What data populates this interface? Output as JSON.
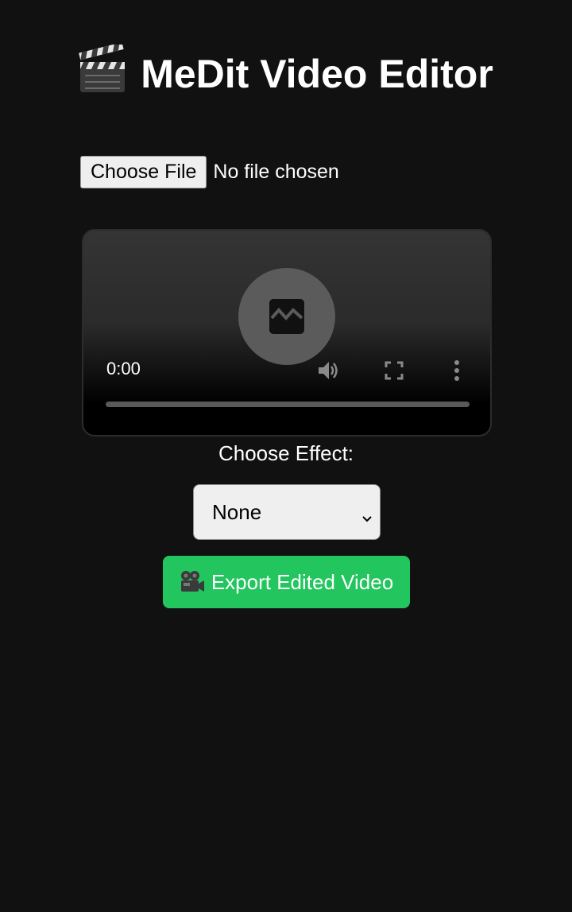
{
  "header": {
    "title": "MeDit Video Editor",
    "icon": "clapperboard-icon"
  },
  "file_input": {
    "button_label": "Choose File",
    "status": "No file chosen"
  },
  "video_player": {
    "time": "0:00",
    "state_icon": "broken-media-icon",
    "controls": [
      "volume-icon",
      "fullscreen-icon",
      "more-options-icon"
    ],
    "progress": 0
  },
  "effect": {
    "label": "Choose Effect:",
    "selected": "None"
  },
  "export": {
    "label": "Export Edited Video",
    "icon": "video-camera-icon",
    "color": "#22c55e"
  },
  "colors": {
    "background": "#111111",
    "accent": "#22c55e"
  }
}
